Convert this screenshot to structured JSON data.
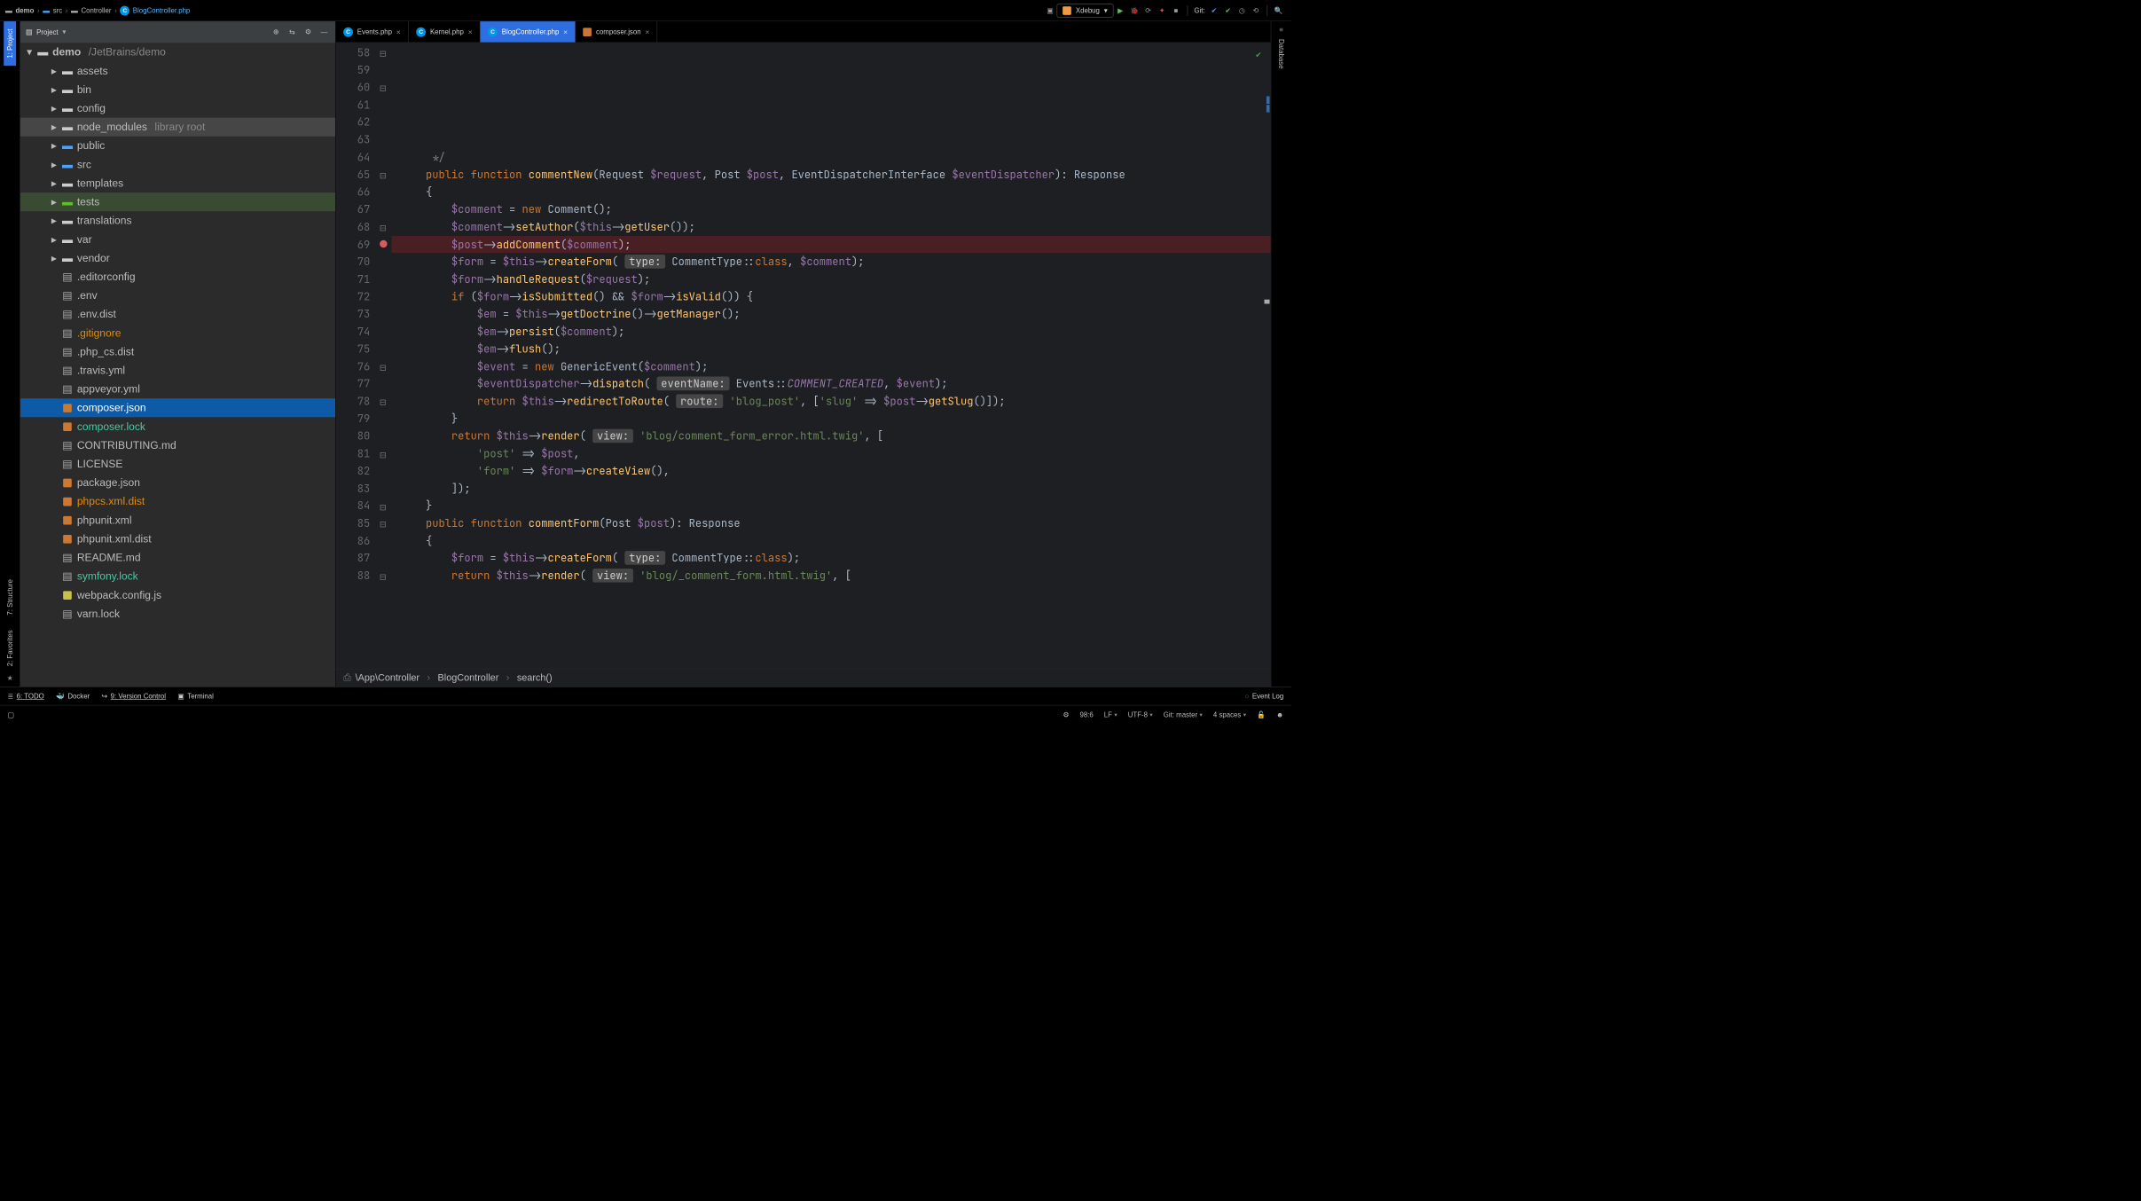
{
  "breadcrumbs": [
    {
      "label": "demo",
      "kind": "folder"
    },
    {
      "label": "src",
      "kind": "folder-blue"
    },
    {
      "label": "Controller",
      "kind": "folder"
    },
    {
      "label": "BlogController.php",
      "kind": "php"
    }
  ],
  "runconfig": {
    "label": "Xdebug"
  },
  "git_label": "Git:",
  "left_tabs": {
    "project": "1: Project",
    "structure": "7: Structure",
    "favorites": "2: Favorites"
  },
  "right_tab": {
    "database": "Database"
  },
  "project_panel": {
    "title": "Project"
  },
  "tree": {
    "root": {
      "name": "demo",
      "path": "/JetBrains/demo"
    },
    "items": [
      {
        "depth": 1,
        "twisty": "▸",
        "icon": "folder",
        "label": "assets"
      },
      {
        "depth": 1,
        "twisty": "▸",
        "icon": "folder",
        "label": "bin"
      },
      {
        "depth": 1,
        "twisty": "▸",
        "icon": "folder",
        "label": "config"
      },
      {
        "depth": 1,
        "twisty": "▸",
        "icon": "folder",
        "label": "node_modules",
        "sub": "library root",
        "dim": true
      },
      {
        "depth": 1,
        "twisty": "▸",
        "icon": "folder-blue",
        "label": "public"
      },
      {
        "depth": 1,
        "twisty": "▸",
        "icon": "folder-blue",
        "label": "src"
      },
      {
        "depth": 1,
        "twisty": "▸",
        "icon": "folder",
        "label": "templates"
      },
      {
        "depth": 1,
        "twisty": "▸",
        "icon": "folder-green",
        "label": "tests",
        "hili": true
      },
      {
        "depth": 1,
        "twisty": "▸",
        "icon": "folder",
        "label": "translations"
      },
      {
        "depth": 1,
        "twisty": "▸",
        "icon": "folder",
        "label": "var"
      },
      {
        "depth": 1,
        "twisty": "▸",
        "icon": "folder",
        "label": "vendor"
      },
      {
        "depth": 1,
        "twisty": "",
        "icon": "file",
        "label": ".editorconfig"
      },
      {
        "depth": 1,
        "twisty": "",
        "icon": "file",
        "label": ".env"
      },
      {
        "depth": 1,
        "twisty": "",
        "icon": "file",
        "label": ".env.dist"
      },
      {
        "depth": 1,
        "twisty": "",
        "icon": "file",
        "label": ".gitignore",
        "cls": "txt-orange"
      },
      {
        "depth": 1,
        "twisty": "",
        "icon": "file",
        "label": ".php_cs.dist"
      },
      {
        "depth": 1,
        "twisty": "",
        "icon": "file",
        "label": ".travis.yml"
      },
      {
        "depth": 1,
        "twisty": "",
        "icon": "file",
        "label": "appveyor.yml"
      },
      {
        "depth": 1,
        "twisty": "",
        "icon": "json",
        "label": "composer.json",
        "sel": true
      },
      {
        "depth": 1,
        "twisty": "",
        "icon": "json",
        "label": "composer.lock",
        "cls": "txt-teal"
      },
      {
        "depth": 1,
        "twisty": "",
        "icon": "file",
        "label": "CONTRIBUTING.md"
      },
      {
        "depth": 1,
        "twisty": "",
        "icon": "file",
        "label": "LICENSE"
      },
      {
        "depth": 1,
        "twisty": "",
        "icon": "json",
        "label": "package.json"
      },
      {
        "depth": 1,
        "twisty": "",
        "icon": "json",
        "label": "phpcs.xml.dist",
        "cls": "txt-orange"
      },
      {
        "depth": 1,
        "twisty": "",
        "icon": "json",
        "label": "phpunit.xml"
      },
      {
        "depth": 1,
        "twisty": "",
        "icon": "json",
        "label": "phpunit.xml.dist"
      },
      {
        "depth": 1,
        "twisty": "",
        "icon": "file",
        "label": "README.md"
      },
      {
        "depth": 1,
        "twisty": "",
        "icon": "file",
        "label": "symfony.lock",
        "cls": "txt-teal"
      },
      {
        "depth": 1,
        "twisty": "",
        "icon": "jsyellow",
        "label": "webpack.config.js"
      },
      {
        "depth": 1,
        "twisty": "",
        "icon": "file",
        "label": "varn.lock"
      }
    ]
  },
  "tabs": [
    {
      "label": "Events.php",
      "icon": "php"
    },
    {
      "label": "Kernel.php",
      "icon": "php"
    },
    {
      "label": "BlogController.php",
      "icon": "php",
      "active": true
    },
    {
      "label": "composer.json",
      "icon": "json"
    }
  ],
  "code": {
    "first_line_no": 58,
    "breakpoint_line": 69,
    "fold_lines": [
      58,
      60,
      65,
      68,
      76,
      78,
      81,
      84,
      85,
      88
    ],
    "lines": [
      {
        "n": 58,
        "html": "     <span class='cmt'>*/</span>"
      },
      {
        "n": 59,
        "html": "    <span class='kw'>public</span> <span class='kw'>function</span> <span class='fn'>commentNew</span>(<span class='typ'>Request</span> <span class='var'>$request</span>, <span class='typ'>Post</span> <span class='var'>$post</span>, <span class='typ'>EventDispatcherInterface</span> <span class='var'>$eventDispatcher</span>): <span class='typ'>Response</span>"
      },
      {
        "n": 60,
        "html": "    {"
      },
      {
        "n": 61,
        "html": "        <span class='var'>$comment</span> = <span class='kw'>new</span> <span class='cls'>Comment</span>();"
      },
      {
        "n": 62,
        "html": "        <span class='var'>$comment</span>-&gt;<span class='fn'>setAuthor</span>(<span class='var'>$this</span>-&gt;<span class='fn'>getUser</span>());"
      },
      {
        "n": 63,
        "html": "        <span class='var'>$post</span>-&gt;<span class='fn'>addComment</span>(<span class='var'>$comment</span>);"
      },
      {
        "n": 64,
        "html": ""
      },
      {
        "n": 65,
        "html": "        <span class='var'>$form</span> = <span class='var'>$this</span>-&gt;<span class='fn'>createForm</span>( <span class='hintpill'>type:</span> <span class='cls'>CommentType</span>::<span class='kw'>class</span>, <span class='var'>$comment</span>);"
      },
      {
        "n": 66,
        "html": "        <span class='var'>$form</span>-&gt;<span class='fn'>handleRequest</span>(<span class='var'>$request</span>);"
      },
      {
        "n": 67,
        "html": ""
      },
      {
        "n": 68,
        "html": "        <span class='kw'>if</span> (<span class='var'>$form</span>-&gt;<span class='fn'>isSubmitted</span>() &amp;&amp; <span class='var'>$form</span>-&gt;<span class='fn'>isValid</span>()) {"
      },
      {
        "n": 69,
        "html": "            <span class='var'>$em</span> = <span class='var'>$this</span>-&gt;<span class='fn'>getDoctrine</span>()-&gt;<span class='fn'>getManager</span>();",
        "bp": true
      },
      {
        "n": 70,
        "html": "            <span class='var'>$em</span>-&gt;<span class='fn'>persist</span>(<span class='var'>$comment</span>);"
      },
      {
        "n": 71,
        "html": "            <span class='var'>$em</span>-&gt;<span class='fn'>flush</span>();"
      },
      {
        "n": 72,
        "html": "            <span class='var'>$event</span> = <span class='kw'>new</span> <span class='cls'>GenericEvent</span>(<span class='var'>$comment</span>);"
      },
      {
        "n": 73,
        "html": "            <span class='var'>$eventDispatcher</span>-&gt;<span class='fn'>dispatch</span>( <span class='hintpill'>eventName:</span> <span class='cls'>Events</span>::<span class='const'>COMMENT_CREATED</span>, <span class='var'>$event</span>);"
      },
      {
        "n": 74,
        "html": ""
      },
      {
        "n": 75,
        "html": "            <span class='kw'>return</span> <span class='var'>$this</span>-&gt;<span class='fn'>redirectToRoute</span>( <span class='hintpill'>route:</span> <span class='str'>'blog_post'</span>, [<span class='str'>'slug'</span> =&gt; <span class='var'>$post</span>-&gt;<span class='fn'>getSlug</span>()]);"
      },
      {
        "n": 76,
        "html": "        }"
      },
      {
        "n": 77,
        "html": ""
      },
      {
        "n": 78,
        "html": "        <span class='kw'>return</span> <span class='var'>$this</span>-&gt;<span class='fn'>render</span>( <span class='hintpill'>view:</span> <span class='str'>'blog/comment_form_error.html.twig'</span>, ["
      },
      {
        "n": 79,
        "html": "            <span class='str'>'post'</span> =&gt; <span class='var'>$post</span>,"
      },
      {
        "n": 80,
        "html": "            <span class='str'>'form'</span> =&gt; <span class='var'>$form</span>-&gt;<span class='fn'>createView</span>(),"
      },
      {
        "n": 81,
        "html": "        ]);"
      },
      {
        "n": 82,
        "html": "    }"
      },
      {
        "n": 83,
        "html": ""
      },
      {
        "n": 84,
        "html": "    <span class='kw'>public</span> <span class='kw'>function</span> <span class='fn'>commentForm</span>(<span class='typ'>Post</span> <span class='var'>$post</span>): <span class='typ'>Response</span>"
      },
      {
        "n": 85,
        "html": "    {"
      },
      {
        "n": 86,
        "html": "        <span class='var'>$form</span> = <span class='var'>$this</span>-&gt;<span class='fn'>createForm</span>( <span class='hintpill'>type:</span> <span class='cls'>CommentType</span>::<span class='kw'>class</span>);"
      },
      {
        "n": 87,
        "html": ""
      },
      {
        "n": 88,
        "html": "        <span class='kw'>return</span> <span class='var'>$this</span>-&gt;<span class='fn'>render</span>( <span class='hintpill'>view:</span> <span class='str'>'blog/_comment_form.html.twig'</span>, ["
      }
    ]
  },
  "nav_breadcrumb": [
    "\\App\\Controller",
    "BlogController",
    "search()"
  ],
  "bottom": {
    "todo": "6: TODO",
    "docker": "Docker",
    "vcs": "9: Version Control",
    "terminal": "Terminal",
    "eventlog": "Event Log"
  },
  "status": {
    "pos": "98:6",
    "le": "LF",
    "enc": "UTF-8",
    "git": "Git: master",
    "indent": "4 spaces"
  }
}
